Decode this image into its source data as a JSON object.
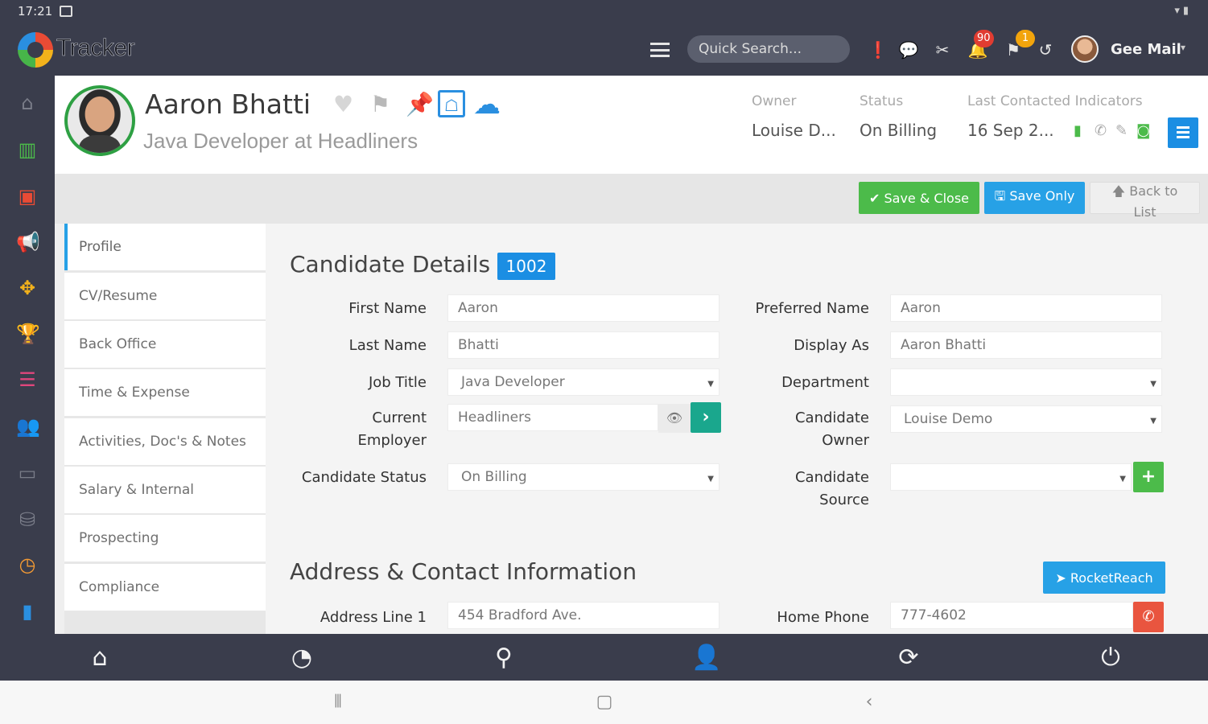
{
  "status_bar": {
    "time": "17:21",
    "right_icons": "wifi battery"
  },
  "app": {
    "logo_text": "Tracker",
    "search_placeholder": "Quick Search...",
    "notifications_badge": "90",
    "flags_badge": "1",
    "user_name": "Gee Mail",
    "accent": "#1b8ee3",
    "header_bg": "#3a3d4c"
  },
  "rail_icons": [
    "home-icon",
    "building-icon",
    "card-icon",
    "megaphone-icon",
    "puzzle-icon",
    "trophy-icon",
    "list-icon",
    "users-icon",
    "money-icon",
    "database-icon",
    "clock-icon",
    "chart-icon"
  ],
  "candidate": {
    "name": "Aaron Bhatti",
    "title": "Java Developer at Headliners",
    "owner_label": "Owner",
    "owner_value": "Louise D...",
    "status_label": "Status",
    "status_value": "On Billing",
    "last_contacted_label": "Last Contacted Indicators",
    "last_contacted_value": "16 Sep 2..."
  },
  "actions": {
    "save_close": "Save & Close",
    "save_only": "Save Only",
    "back_to_list": "Back to List"
  },
  "tabs": [
    {
      "label": "Profile"
    },
    {
      "label": "CV/Resume"
    },
    {
      "label": "Back Office"
    },
    {
      "label": "Time & Expense"
    },
    {
      "label": "Activities, Doc's & Notes"
    },
    {
      "label": "Salary & Internal"
    },
    {
      "label": "Prospecting"
    },
    {
      "label": "Compliance"
    }
  ],
  "details": {
    "title": "Candidate Details",
    "id": "1002",
    "first_name_label": "First Name",
    "first_name": "Aaron",
    "last_name_label": "Last Name",
    "last_name": "Bhatti",
    "job_title_label": "Job Title",
    "job_title": "Java Developer",
    "employer_label_1": "Current",
    "employer_label_2": "Employer",
    "employer": "Headliners",
    "status_label": "Candidate Status",
    "status": "On Billing",
    "preferred_name_label": "Preferred Name",
    "preferred_name": "Aaron",
    "display_as_label": "Display As",
    "display_as": "Aaron Bhatti",
    "department_label": "Department",
    "department": "",
    "owner_label_1": "Candidate",
    "owner_label_2": "Owner",
    "owner": "Louise Demo",
    "source_label_1": "Candidate",
    "source_label_2": "Source",
    "source": ""
  },
  "address": {
    "title": "Address & Contact Information",
    "rocketreach": "RocketReach",
    "line1_label": "Address Line 1",
    "line1": "454 Bradford Ave.",
    "home_phone_label": "Home Phone",
    "home_phone": "777-4602"
  }
}
